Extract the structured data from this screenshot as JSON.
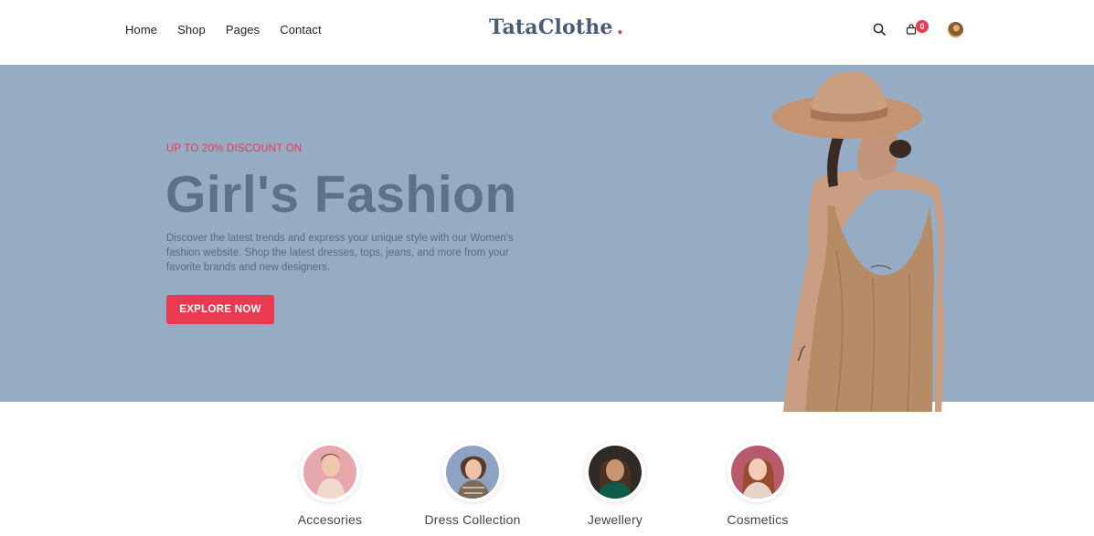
{
  "header": {
    "nav": [
      "Home",
      "Shop",
      "Pages",
      "Contact"
    ],
    "logo_text": "TataClothe",
    "logo_dot": ".",
    "cart_count": "0",
    "icons": {
      "search": "search-icon",
      "cart": "shopping-bag-icon",
      "account": "user-avatar"
    }
  },
  "hero": {
    "kicker": "UP TO 20% DISCOUNT ON",
    "title": "Girl's Fashion",
    "description": "Discover the latest trends and express your unique style with our Women's fashion website. Shop the latest dresses, tops, jeans, and more from your favorite brands and new designers.",
    "cta_label": "EXPLORE NOW",
    "background_color": "#96abc4",
    "accent_color": "#ea3a4f"
  },
  "categories": [
    {
      "label": "Accesories"
    },
    {
      "label": "Dress Collection"
    },
    {
      "label": "Jewellery"
    },
    {
      "label": "Cosmetics"
    }
  ]
}
